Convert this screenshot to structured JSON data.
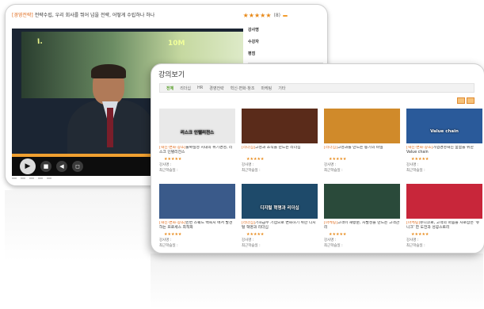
{
  "player": {
    "category": "[경영전략]",
    "title": "전략수립, 우리 회사를 뛰어 넘을 전략, 어떻게 수립하나 하나",
    "rating_count": "(8)",
    "rating_button": "",
    "slide_text_left": "I.",
    "slide_text_right": "10M",
    "progress": 0.6,
    "controls": [
      "play-icon",
      "stop-icon",
      "volume-icon",
      "fullscreen-icon"
    ],
    "bottom_buttons": [
      "",
      "",
      "",
      "",
      ""
    ],
    "side": {
      "rows": [
        {
          "label": "강사명",
          "value": "",
          "badge": ""
        },
        {
          "label": "수강자",
          "value": "",
          "badge": ""
        },
        {
          "label": "평점",
          "value": "",
          "badge": ""
        }
      ],
      "note": ""
    }
  },
  "catalog": {
    "heading": "강의보기",
    "more": "",
    "filters": [
      "전체",
      "리더십",
      "HR",
      "경영전략",
      "혁신·변화·창조",
      "마케팅",
      "기타"
    ],
    "cards": [
      {
        "thumb_title": "리스크 인텔리전스",
        "thumb_caption": "",
        "category": "[혁신·변화·창조]",
        "title": "불확실성 시대의 위기경영, 리스크 인텔리전스",
        "badge": "",
        "meta": "",
        "instructor": "강사명 :",
        "recent": "최근학습일 :",
        "bg": "#e9e9e9",
        "fg": "#222"
      },
      {
        "thumb_title": "",
        "thumb_caption": "",
        "category": "[리더십]",
        "title": "고성과 조직을 만드는 리더십",
        "badge": "",
        "meta": "",
        "instructor": "강사명 :",
        "recent": "최근학습일 :",
        "bg": "#5a2b1a",
        "fg": "#fff"
      },
      {
        "thumb_title": "",
        "thumb_caption": "",
        "category": "[리더십]",
        "title": "고성과를 만드는 동기의 비밀",
        "badge": "",
        "meta": "",
        "instructor": "강사명 :",
        "recent": "최근학습일 :",
        "bg": "#d08a2a",
        "fg": "#fff"
      },
      {
        "thumb_title": "Value chain",
        "thumb_caption": "",
        "category": "[혁신·변화·창조]",
        "title": "가업경영혁신 꿈꿈을 위한 Value chain",
        "badge": "",
        "meta": "",
        "instructor": "강사명 :",
        "recent": "최근학습일 :",
        "bg": "#2a5a9a",
        "fg": "#fff"
      },
      {
        "thumb_title": "",
        "thumb_caption": "",
        "category": "[혁신·변화·창조]",
        "title": "빈번 스퀘드 백쪽지 에서 발견하는 프로세스 최적화",
        "badge": "",
        "meta": "",
        "instructor": "강사명 :",
        "recent": "최근학습일 :",
        "bg": "#3a5a8a",
        "fg": "#fff"
      },
      {
        "thumb_title": "디지털 혁명과 리더십",
        "thumb_caption": "",
        "category": "[리더십]",
        "title": "기하급수 기업으로 변화하기 위한 디지털 혁명과 리더십",
        "badge": "",
        "meta": "",
        "instructor": "강사명 :",
        "recent": "최근학습일 :",
        "bg": "#1e4a6a",
        "fg": "#fff"
      },
      {
        "thumb_title": "",
        "thumb_caption": "",
        "category": "[마케팅]",
        "title": "고객이 재방문, 자발성을 만드는 고객관리",
        "badge": "",
        "meta": "",
        "instructor": "강사명 :",
        "recent": "최근학습일 :",
        "bg": "#2a4a3a",
        "fg": "#fff"
      },
      {
        "thumb_title": "",
        "thumb_caption": "",
        "category": "[마케팅]",
        "title": "유니코로, 고객의 마음을 사로잡은 '유니크' 한 도전과 성공스토리",
        "badge": "",
        "meta": "",
        "instructor": "강사명 :",
        "recent": "최근학습일 :",
        "bg": "#c8263a",
        "fg": "#fff"
      }
    ]
  },
  "colors": {
    "accent": "#f39c2d",
    "green": "#7dbb3a",
    "category": "#e06a1a"
  }
}
